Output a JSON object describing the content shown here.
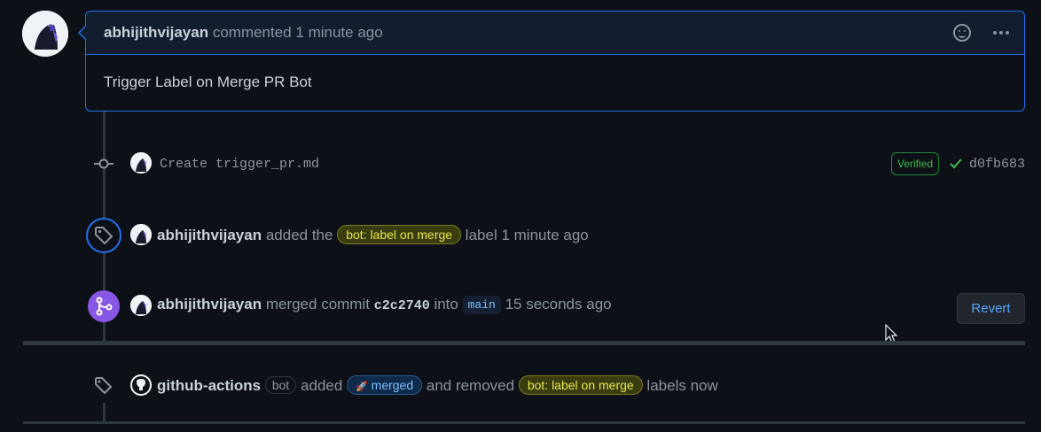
{
  "comment": {
    "author": "abhijithvijayan",
    "action": "commented",
    "time": "1 minute ago",
    "body": "Trigger Label on Merge PR Bot"
  },
  "commit": {
    "message": "Create trigger_pr.md",
    "verified": "Verified",
    "sha": "d0fb683"
  },
  "label_event": {
    "author": "abhijithvijayan",
    "text1": "added the",
    "label": "bot: label on merge",
    "text2": "label",
    "time": "1 minute ago"
  },
  "merge_event": {
    "author": "abhijithvijayan",
    "text1": "merged commit",
    "commit": "c2c2740",
    "text2": "into",
    "branch": "main",
    "time": "15 seconds ago",
    "revert_label": "Revert"
  },
  "bot_event": {
    "author": "github-actions",
    "badge": "bot",
    "text1": "added",
    "added_label": "merged",
    "added_label_emoji": "🚀",
    "text2": "and removed",
    "removed_label": "bot: label on merge",
    "text3": "labels",
    "time": "now"
  },
  "colors": {
    "accent": "#1f6feb",
    "merged": "#8957e5",
    "background": "#0d1117"
  }
}
